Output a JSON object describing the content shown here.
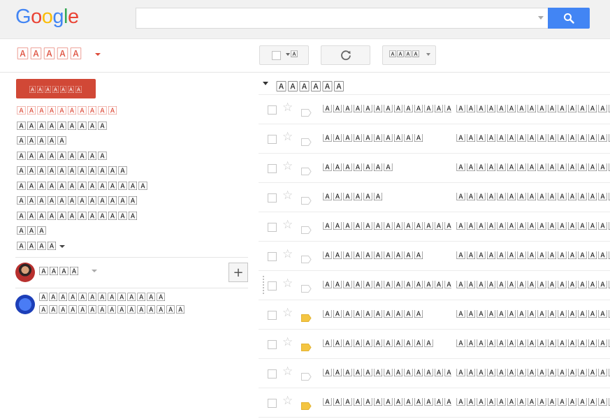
{
  "header": {
    "logo_letters": [
      "G",
      "o",
      "o",
      "g",
      "l",
      "e"
    ],
    "logo_colors": [
      "#4285f4",
      "#ea4335",
      "#fbbc05",
      "#4285f4",
      "#34a853",
      "#ea4335"
    ],
    "search": {
      "value": "",
      "placeholder": ""
    }
  },
  "brand": {
    "label": "🄰🄰🄰🄰🄰"
  },
  "toolbar": {
    "select_label": "🄰",
    "more_label": "🄰🄰🄰🄰"
  },
  "sidebar": {
    "compose_label": "🄰🄰🄰🄰🄰🄰🄰",
    "items": [
      {
        "label": "🄰🄰🄰🄰🄰🄰🄰🄰🄰🄰",
        "active": true
      },
      {
        "label": "🄰🄰🄰🄰🄰🄰🄰🄰🄰",
        "active": false
      },
      {
        "label": "🄰🄰🄰🄰🄰",
        "active": false
      },
      {
        "label": "🄰🄰🄰🄰🄰🄰🄰🄰🄰",
        "active": false
      },
      {
        "label": "🄰🄰🄰🄰🄰🄰🄰🄰🄰🄰🄰",
        "active": false
      },
      {
        "label": "🄰🄰🄰🄰🄰🄰🄰🄰🄰🄰🄰🄰🄰",
        "active": false
      },
      {
        "label": "🄰🄰🄰🄰🄰🄰🄰🄰🄰🄰🄰🄰",
        "active": false
      },
      {
        "label": "🄰🄰🄰🄰🄰🄰🄰🄰🄰🄰🄰🄰",
        "active": false
      },
      {
        "label": "🄰🄰🄰",
        "active": false
      },
      {
        "label": "🄰🄰🄰🄰",
        "active": false,
        "caret": true
      }
    ]
  },
  "hangouts": {
    "user_name": "🄰🄰🄰🄰",
    "contacts": [
      {
        "line1": "🄰🄰🄰🄰🄰🄰🄰🄰🄰🄰🄰🄰🄰",
        "line2": "🄰🄰🄰🄰🄰🄰🄰🄰🄰🄰🄰🄰🄰🄰🄰"
      }
    ]
  },
  "main": {
    "section_title": "🄰🄰🄰🄰🄰🄰",
    "rows": [
      {
        "sender": "🄰🄰🄰🄰🄰🄰🄰🄰🄰🄰🄰🄰🄰🄰🄰🄰",
        "subject": "🄰🄰🄰🄰🄰🄰🄰🄰🄰🄰🄰🄰🄰🄰🄰🄰🄰🄰",
        "important": false
      },
      {
        "sender": "🄰🄰🄰🄰🄰🄰🄰🄰🄰🄰",
        "subject": "🄰🄰🄰🄰🄰🄰🄰🄰🄰🄰🄰🄰🄰🄰🄰🄰🄰🄰",
        "important": false
      },
      {
        "sender": "🄰🄰🄰🄰🄰🄰🄰",
        "subject": "🄰🄰🄰🄰🄰🄰🄰🄰🄰🄰🄰🄰🄰🄰🄰🄰🄰🄰",
        "important": false
      },
      {
        "sender": "🄰🄰🄰🄰🄰🄰",
        "subject": "🄰🄰🄰🄰🄰🄰🄰🄰🄰🄰🄰🄰🄰🄰🄰🄰🄰🄰",
        "important": false
      },
      {
        "sender": "🄰🄰🄰🄰🄰🄰🄰🄰🄰🄰🄰🄰🄰🄰🄰🄰",
        "subject": "🄰🄰🄰🄰🄰🄰🄰🄰🄰🄰🄰🄰🄰🄰🄰🄰🄰🄰",
        "important": false
      },
      {
        "sender": "🄰🄰🄰🄰🄰🄰🄰🄰🄰🄰",
        "subject": "🄰🄰🄰🄰🄰🄰🄰🄰🄰🄰🄰🄰🄰🄰🄰🄰🄰🄰",
        "important": false
      },
      {
        "sender": "🄰🄰🄰🄰🄰🄰🄰🄰🄰🄰🄰🄰🄰🄰🄰🄰",
        "subject": "🄰🄰🄰🄰🄰🄰🄰🄰🄰🄰🄰🄰🄰🄰🄰🄰🄰🄰",
        "important": false
      },
      {
        "sender": "🄰🄰🄰🄰🄰🄰🄰🄰🄰🄰",
        "subject": "🄰🄰🄰🄰🄰🄰🄰🄰🄰🄰🄰🄰🄰🄰🄰🄰🄰🄰",
        "important": true
      },
      {
        "sender": "🄰🄰🄰🄰🄰🄰🄰🄰🄰🄰🄰",
        "subject": "🄰🄰🄰🄰🄰🄰🄰🄰🄰🄰🄰🄰🄰🄰🄰🄰🄰🄰",
        "important": true
      },
      {
        "sender": "🄰🄰🄰🄰🄰🄰🄰🄰🄰🄰🄰🄰🄰🄰🄰🄰",
        "subject": "🄰🄰🄰🄰🄰🄰🄰🄰🄰🄰🄰🄰🄰🄰🄰🄰🄰🄰",
        "important": false
      },
      {
        "sender": "🄰🄰🄰🄰🄰🄰🄰🄰🄰🄰🄰🄰🄰🄰🄰🄰",
        "subject": "🄰🄰🄰🄰🄰🄰🄰🄰🄰🄰🄰🄰🄰🄰🄰🄰🄰🄰",
        "important": true
      }
    ]
  },
  "colors": {
    "accent_red": "#dd4b39",
    "compose_bg": "#d14836",
    "search_blue": "#4285f4",
    "important_yellow": "#f4c542"
  }
}
